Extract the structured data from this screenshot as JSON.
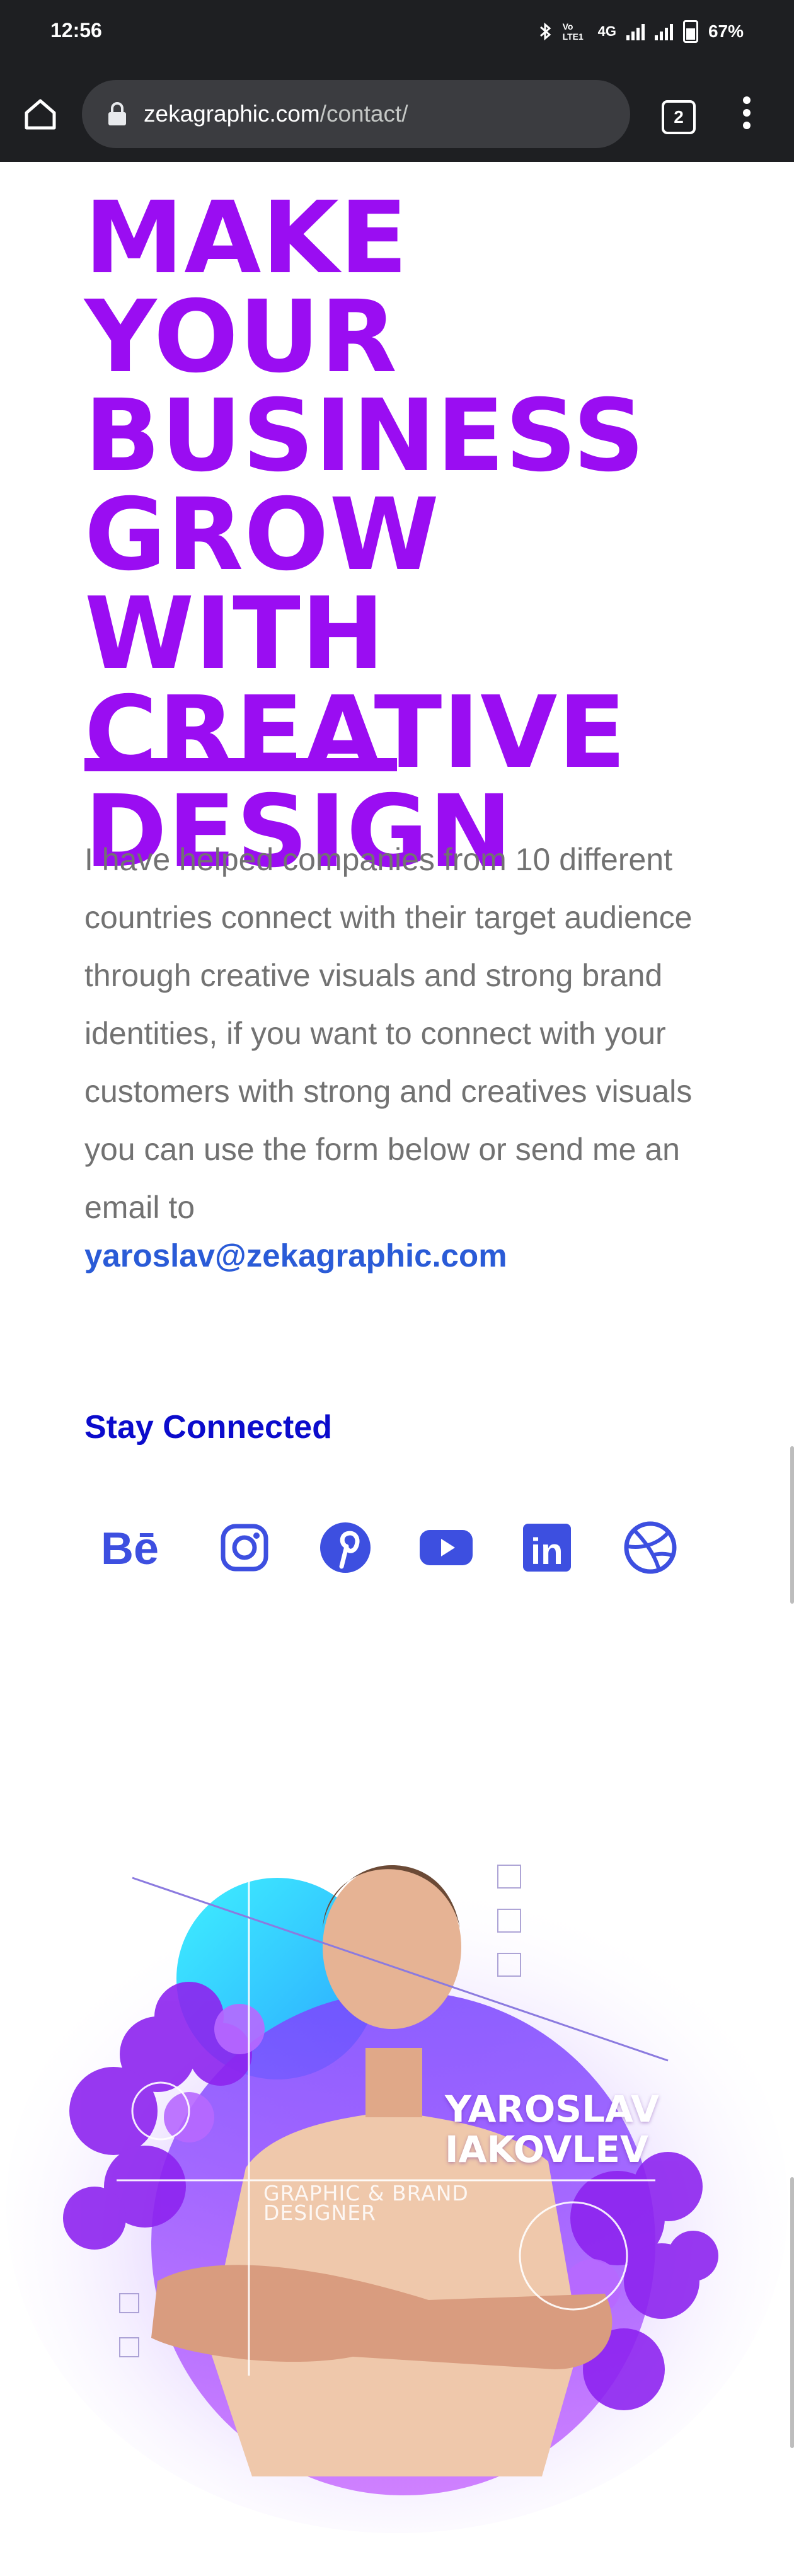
{
  "status_bar": {
    "time": "12:56",
    "network_label": "4G",
    "volte_label": "Vo LTE1",
    "battery": "67%"
  },
  "browser": {
    "url_host": "zekagraphic.com",
    "url_path": "/contact/",
    "tab_count": "2"
  },
  "content": {
    "headline": "MAKE YOUR BUSINESS GROW WITH CREATIVE DESIGN",
    "intro": "I have helped companies from 10 different countries connect with their target audience through creative visuals and strong brand identities, if you want to connect with your customers with strong and creatives visuals you can use the form below or send me an email to",
    "email": "yaroslav@zekagraphic.com",
    "stay_connected": "Stay Connected",
    "socials": [
      {
        "icon": "behance-icon",
        "label": "Bē"
      },
      {
        "icon": "instagram-icon"
      },
      {
        "icon": "pinterest-icon"
      },
      {
        "icon": "youtube-icon"
      },
      {
        "icon": "linkedin-icon",
        "label": "in"
      },
      {
        "icon": "dribbble-icon"
      }
    ]
  },
  "portrait": {
    "name": "YAROSLAV\nIAKOVLEV",
    "role": "GRAPHIC & BRAND\nDESIGNER"
  },
  "colors": {
    "headline_purple": "#9a0df2",
    "link_blue": "#2a5bd7",
    "icon_blue": "#3d4fe0",
    "stay_blue": "#0b0bcc"
  }
}
